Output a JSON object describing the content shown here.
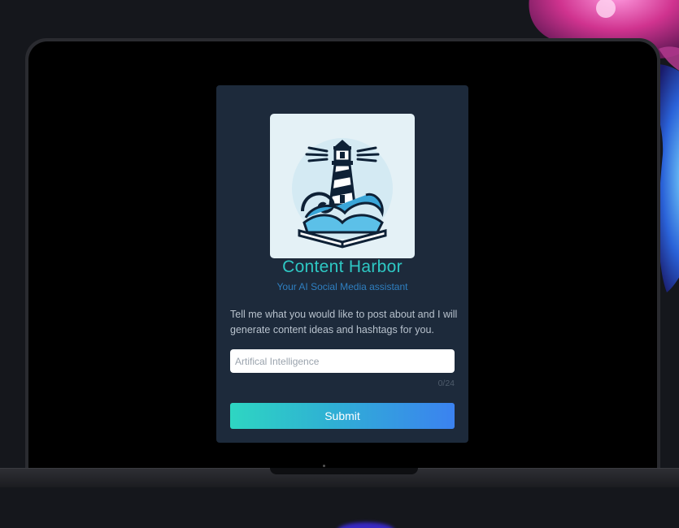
{
  "app": {
    "title": "Content Harbor",
    "subtitle": "Your AI Social Media assistant",
    "logo_icon": "lighthouse-book-icon"
  },
  "main": {
    "description": "Tell me what you would like to post about and I will generate content ideas and hashtags for you."
  },
  "form": {
    "topic_placeholder": "Artifical Intelligence",
    "topic_value": "",
    "char_counter": "0/24",
    "submit_label": "Submit"
  },
  "colors": {
    "background": "#15171c",
    "card": "#1d2a3b",
    "title_accent": "#2ec8c4",
    "subtitle_accent": "#2f7fc0",
    "button_gradient_start": "#2ed6c2",
    "button_gradient_end": "#3b82f0"
  }
}
